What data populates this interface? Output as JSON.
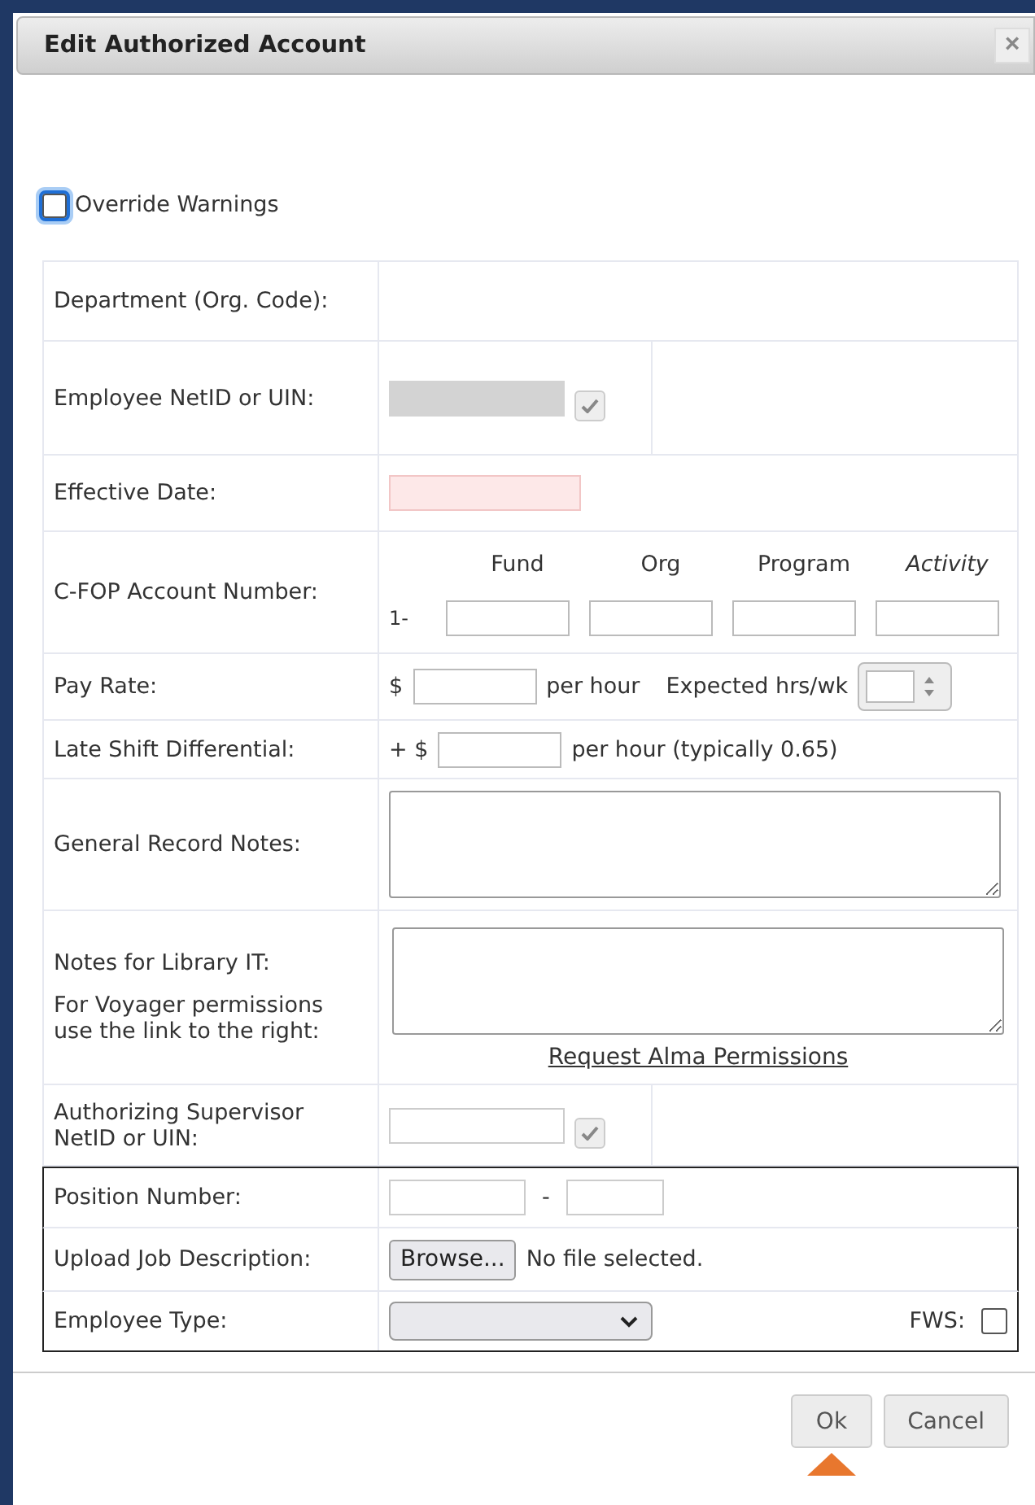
{
  "dialog": {
    "title": "Edit Authorized Account",
    "close": "×"
  },
  "override": {
    "label": "Override Warnings",
    "checked": false
  },
  "rows": [
    {
      "kind": "empty",
      "label": "Department (Org. Code):"
    },
    {
      "kind": "netid",
      "label": "Employee NetID or UIN:",
      "disabled": true
    },
    {
      "kind": "date",
      "label": "Effective Date:",
      "invalid": true
    },
    {
      "kind": "cfop",
      "label": "C-FOP Account Number:",
      "prefix": "1-",
      "headers": [
        {
          "text": "Fund",
          "italic": false
        },
        {
          "text": "Org",
          "italic": false
        },
        {
          "text": "Program",
          "italic": false
        },
        {
          "text": "Activity",
          "italic": true
        }
      ]
    },
    {
      "kind": "pay",
      "label": "Pay Rate:",
      "prefix": "$",
      "suffix": "per hour",
      "extra": "Expected hrs/wk"
    },
    {
      "kind": "late",
      "label": "Late Shift Differential:",
      "prefix": "+ $",
      "suffix": "per hour (typically 0.65)"
    },
    {
      "kind": "textarea",
      "label": "General Record Notes:"
    },
    {
      "kind": "notes",
      "label": "Notes for Library IT:",
      "sublabel": "For Voyager permissions use the link to the right:",
      "link": "Request Alma Permissions"
    },
    {
      "kind": "netid",
      "label": "Authorizing Supervisor NetID or UIN:",
      "disabled": false
    }
  ],
  "boxed_rows": [
    {
      "kind": "position",
      "label": "Position Number:",
      "separator": "-"
    },
    {
      "kind": "upload",
      "label": "Upload Job Description:",
      "button": "Browse...",
      "status": "No file selected."
    },
    {
      "kind": "select",
      "label": "Employee Type:",
      "extra": "FWS:",
      "checked": false
    }
  ],
  "buttons": [
    {
      "label": "Ok"
    },
    {
      "label": "Cancel"
    }
  ]
}
